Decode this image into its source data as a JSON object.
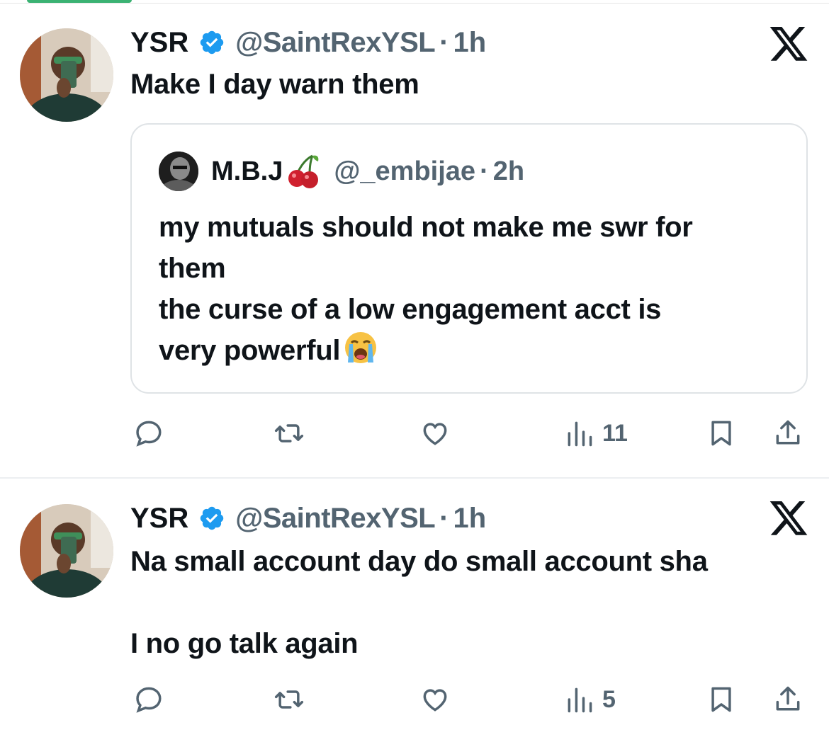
{
  "tweets": [
    {
      "author": {
        "name": "YSR",
        "handle": "@SaintRexYSL",
        "verified": true
      },
      "time": "1h",
      "text": "Make I day warn them",
      "quote": {
        "author": {
          "name": "M.B.J",
          "handle": "@_embijae",
          "emoji": "cherries"
        },
        "time": "2h",
        "lines": [
          "my mutuals should not make me swr for",
          "them",
          "the curse of a low engagement acct is",
          "very powerful"
        ],
        "trailing_emoji": "loudly-crying-face"
      },
      "stats": {
        "views": "11"
      }
    },
    {
      "author": {
        "name": "YSR",
        "handle": "@SaintRexYSL",
        "verified": true
      },
      "time": "1h",
      "text": "Na small account day do small account sha\n\nI no go talk again",
      "stats": {
        "views": "5"
      }
    }
  ],
  "separator": "·",
  "colors": {
    "verified": "#1d9bf0",
    "secondary": "#536471",
    "text": "#0f1419",
    "border": "#dfe3e6"
  }
}
